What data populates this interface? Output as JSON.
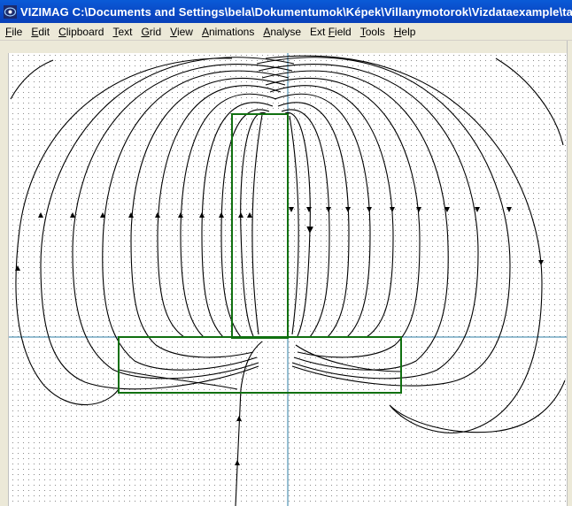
{
  "window": {
    "title": "VIZIMAG C:\\Documents and Settings\\bela\\Dokumentumok\\Képek\\Villanymotorok\\Vizdataexample\\talpa",
    "icon": "vizimag-app-icon"
  },
  "menu": [
    {
      "pre": "",
      "mn": "F",
      "post": "ile"
    },
    {
      "pre": "",
      "mn": "E",
      "post": "dit"
    },
    {
      "pre": "",
      "mn": "C",
      "post": "lipboard"
    },
    {
      "pre": "",
      "mn": "T",
      "post": "ext"
    },
    {
      "pre": "",
      "mn": "G",
      "post": "rid"
    },
    {
      "pre": "",
      "mn": "V",
      "post": "iew"
    },
    {
      "pre": "",
      "mn": "A",
      "post": "nimations"
    },
    {
      "pre": "",
      "mn": "A",
      "post": "nalyse"
    },
    {
      "pre": "Ext ",
      "mn": "F",
      "post": "ield"
    },
    {
      "pre": "",
      "mn": "T",
      "post": "ools"
    },
    {
      "pre": "",
      "mn": "H",
      "post": "elp"
    }
  ],
  "colors": {
    "field_line": "#000000",
    "magnet_outline": "#107010",
    "axis_line": "#2e7ea6",
    "grid_dot": "#8a8a8a",
    "titlebar": "#0a50cc"
  },
  "canvas": {
    "grid": true,
    "axes": true
  }
}
